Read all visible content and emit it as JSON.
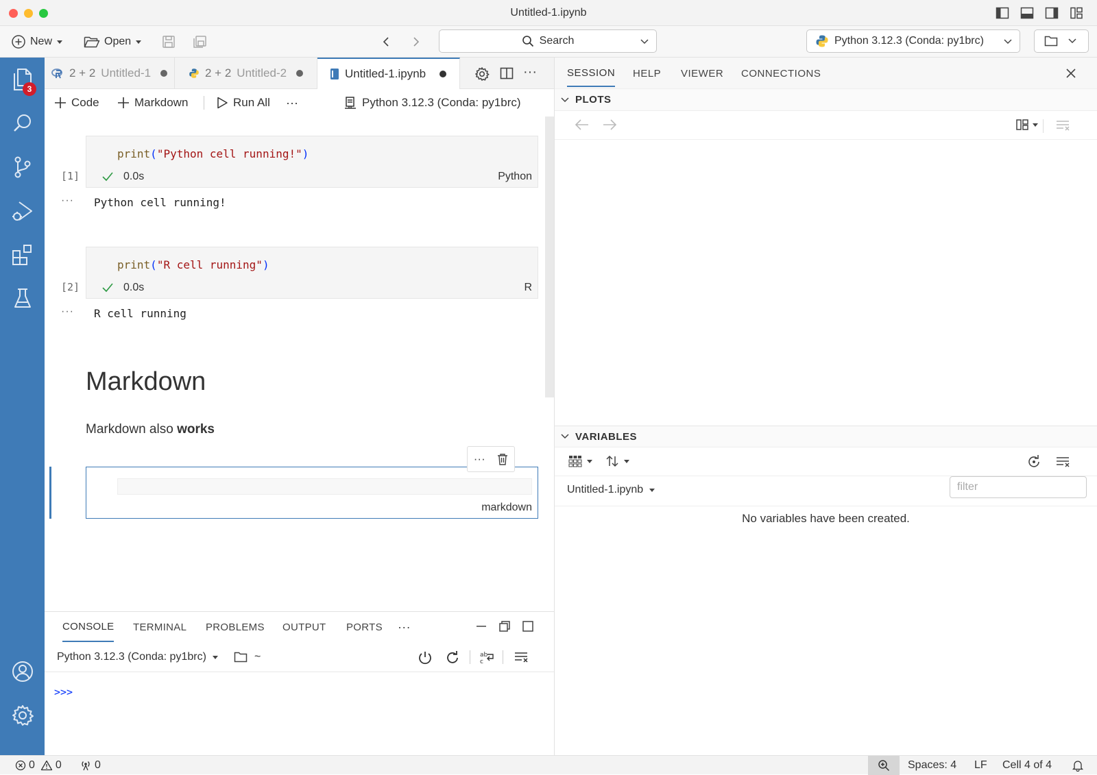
{
  "window": {
    "title": "Untitled-1.ipynb"
  },
  "toolbar": {
    "new_label": "New",
    "open_label": "Open",
    "search_label": "Search",
    "interpreter_label": "Python 3.12.3 (Conda: py1brc)"
  },
  "activity": {
    "explorer_badge": "3"
  },
  "editor_tabs": [
    {
      "title": "2 + 2",
      "subtitle": "Untitled-1"
    },
    {
      "title": "2 + 2",
      "subtitle": "Untitled-2"
    },
    {
      "title": "Untitled-1.ipynb"
    }
  ],
  "notebook_toolbar": {
    "code_label": "Code",
    "markdown_label": "Markdown",
    "run_all_label": "Run All",
    "kernel_label": "Python 3.12.3 (Conda: py1brc)"
  },
  "cells": [
    {
      "fn": "print",
      "open": "(",
      "arg": "\"Python cell running!\"",
      "close": ")",
      "count": "[1]",
      "time": "0.0s",
      "lang": "Python",
      "output": "Python cell running!"
    },
    {
      "fn": "print",
      "open": "(",
      "arg": "\"R cell running\"",
      "close": ")",
      "count": "[2]",
      "time": "0.0s",
      "lang": "R",
      "output": "R cell running"
    }
  ],
  "markdown": {
    "heading": "Markdown",
    "body_text": "Markdown also ",
    "body_bold": "works",
    "edit_cell_lang": "markdown"
  },
  "output_dots": "···",
  "panel": {
    "tabs": [
      "CONSOLE",
      "TERMINAL",
      "PROBLEMS",
      "OUTPUT",
      "PORTS"
    ],
    "more": "···",
    "session_label": "Python 3.12.3 (Conda: py1brc)",
    "cwd": "~",
    "prompt": ">>>"
  },
  "aux": {
    "tabs": [
      "SESSION",
      "HELP",
      "VIEWER",
      "CONNECTIONS"
    ],
    "plots_header": "PLOTS",
    "variables_header": "VARIABLES",
    "variables_source": "Untitled-1.ipynb",
    "filter_placeholder": "filter",
    "empty_message": "No variables have been created."
  },
  "status": {
    "errors": "0",
    "warnings": "0",
    "ports": "0",
    "spaces": "Spaces: 4",
    "eol": "LF",
    "cell_position": "Cell 4 of 4"
  },
  "colors": {
    "accent": "#3f7bb7",
    "activity_bg": "#3f7bb7",
    "badge": "#d21d2a",
    "check": "#2e9a44"
  }
}
